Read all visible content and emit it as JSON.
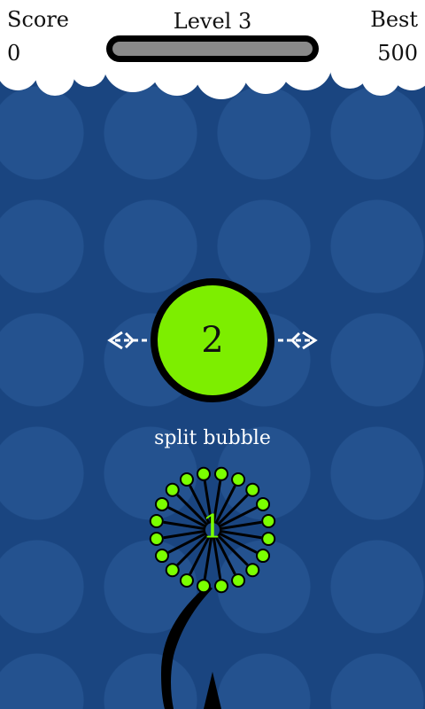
{
  "hud": {
    "score_label": "Score",
    "score_value": "0",
    "level_label": "Level 3",
    "best_label": "Best",
    "best_value": "500",
    "level_progress": 0.0
  },
  "bubble": {
    "number": "2"
  },
  "hint": {
    "text": "split bubble"
  },
  "shooter": {
    "number": "1",
    "dot_count": 20
  },
  "colors": {
    "background": "#1a4580",
    "background_circle": "#24528f",
    "bubble_fill": "#7dee00",
    "accent_green": "#7bff00",
    "cloud": "#ffffff",
    "hint_text": "#ffffff"
  },
  "icons": {
    "split_left": "split-left-arrow-icon",
    "split_right": "split-right-arrow-icon",
    "shooter_rays": "shooter-rays-icon"
  }
}
